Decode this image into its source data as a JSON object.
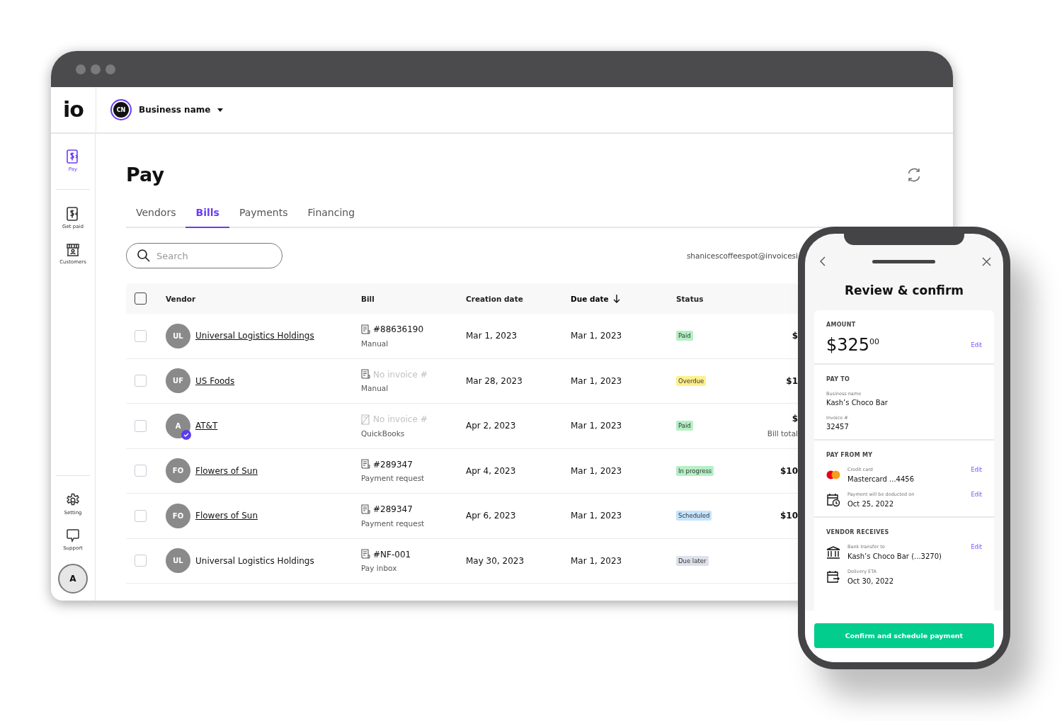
{
  "logo": "io",
  "business": {
    "initials": "CN",
    "name": "Business name"
  },
  "sidebar": {
    "top": [
      {
        "label": "Pay",
        "kind": "pay",
        "selected": true
      }
    ],
    "items": [
      {
        "label": "Get paid",
        "kind": "getpaid",
        "selected": false
      },
      {
        "label": "Customers",
        "kind": "store",
        "selected": false
      }
    ],
    "bottom": [
      {
        "label": "Setting",
        "kind": "gear",
        "selected": false
      },
      {
        "label": "Support",
        "kind": "chat",
        "selected": false
      }
    ],
    "avatar": "A"
  },
  "page": {
    "title": "Pay"
  },
  "tabs": [
    {
      "label": "Vendors",
      "selected": false
    },
    {
      "label": "Bills",
      "selected": true
    },
    {
      "label": "Payments",
      "selected": false
    },
    {
      "label": "Financing",
      "selected": false
    }
  ],
  "search": {
    "placeholder": "Search"
  },
  "email": "shanicescoffeespot@invoicesi",
  "table": {
    "header_checkbox": {
      "checked": false
    },
    "columns": [
      {
        "label": "Vendor",
        "sorted": false
      },
      {
        "label": "Bill",
        "sorted": false
      },
      {
        "label": "Creation date",
        "sorted": false
      },
      {
        "label": "Due date",
        "sorted": true
      },
      {
        "label": "Status",
        "sorted": false
      }
    ],
    "rows": [
      {
        "checked": false,
        "initials": "UL",
        "verified": false,
        "vendor": "Universal Logistics Holdings",
        "linked": true,
        "kind": "receipt",
        "bill": "#88636190",
        "missing": false,
        "source": "Manual",
        "created": "Mar 1, 2023",
        "due": "Mar 1, 2023",
        "status": "Paid",
        "color": "#b4f0c4",
        "amount": "$"
      },
      {
        "checked": false,
        "initials": "UF",
        "verified": false,
        "vendor": "US Foods",
        "linked": true,
        "kind": "receipt",
        "bill": "No invoice #",
        "missing": true,
        "source": "Manual",
        "created": "Mar 28, 2023",
        "due": "Mar 1, 2023",
        "status": "Overdue",
        "color": "#fff08a",
        "amount": "$1"
      },
      {
        "checked": false,
        "initials": "A",
        "verified": true,
        "vendor": "AT&T",
        "linked": true,
        "kind": "receipt_off",
        "bill": "No invoice #",
        "missing": true,
        "source": "QuickBooks",
        "created": "Apr 2, 2023",
        "due": "Mar 1, 2023",
        "status": "Paid",
        "color": "#b4f0c4",
        "amount": "$",
        "amount_note": "Bill total"
      },
      {
        "checked": false,
        "initials": "FO",
        "verified": false,
        "vendor": "Flowers of Sun",
        "linked": true,
        "kind": "receipt",
        "bill": "#289347",
        "missing": false,
        "source": "Payment request",
        "created": "Apr 4, 2023",
        "due": "Mar 1, 2023",
        "status": "In progress",
        "color": "#b4f0c4",
        "amount": "$10"
      },
      {
        "checked": false,
        "initials": "FO",
        "verified": false,
        "vendor": "Flowers of Sun",
        "linked": true,
        "kind": "receipt",
        "bill": "#289347",
        "missing": false,
        "source": "Payment request",
        "created": "Apr 6, 2023",
        "due": "Mar 1, 2023",
        "status": "Scheduled",
        "color": "#c4e4ff",
        "amount": "$10"
      },
      {
        "checked": false,
        "initials": "UL",
        "verified": false,
        "vendor": "Universal Logistics Holdings",
        "linked": false,
        "kind": "receipt",
        "bill": "#NF-001",
        "missing": false,
        "source": "Pay inbox",
        "created": "May 30, 2023",
        "due": "Mar 1, 2023",
        "status": "Due later",
        "color": "#dde1ea"
      }
    ]
  },
  "phone": {
    "title": "Review & confirm",
    "amount": {
      "label": "AMOUNT",
      "value": "$325$^{00}$",
      "edit": "Edit"
    },
    "pay_to": {
      "label": "PAY TO",
      "fields": [
        {
          "label": "Business name",
          "value": "Kash’s Choco Bar"
        },
        {
          "label": "Invoice #",
          "value": "32457"
        }
      ]
    },
    "sections": [
      {
        "label": "PAY FROM MY",
        "items": [
          {
            "kind": "card",
            "label": "Credit card",
            "value": "Mastercard ...4456",
            "edit": "Edit"
          },
          {
            "kind": "calendar_clock",
            "label": "Payment will be deducted on",
            "value": "Oct 25, 2022",
            "edit": "Edit"
          }
        ]
      },
      {
        "label": "VENDOR RECEIVES",
        "items": [
          {
            "kind": "bank",
            "label": "Bank transfer to",
            "value": "Kash’s Choco Bar (...3270)",
            "edit": "Edit"
          },
          {
            "kind": "calendar_out",
            "label": "Delivery ETA",
            "value": "Oct 30, 2022"
          }
        ]
      }
    ],
    "button": "Confirm and schedule payment"
  }
}
